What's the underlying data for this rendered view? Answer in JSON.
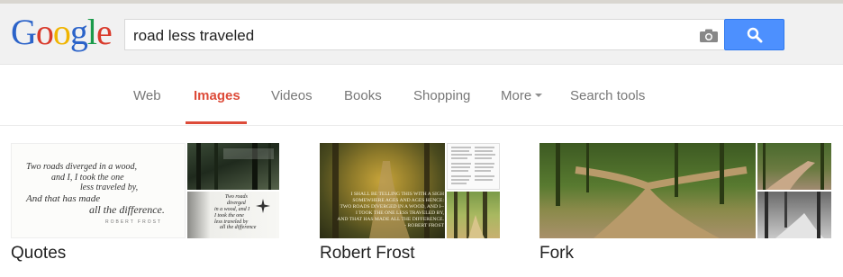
{
  "logo": {
    "letters": [
      "G",
      "o",
      "o",
      "g",
      "l",
      "e"
    ],
    "colors": [
      "#2b63c9",
      "#d93a2b",
      "#f0b400",
      "#2b63c9",
      "#1a9a4a",
      "#d93a2b"
    ]
  },
  "search": {
    "value": "road less traveled",
    "camera_icon": "camera-icon",
    "button_icon": "search-icon"
  },
  "nav": {
    "tabs": [
      {
        "label": "Web",
        "active": false
      },
      {
        "label": "Images",
        "active": true
      },
      {
        "label": "Videos",
        "active": false
      },
      {
        "label": "Books",
        "active": false
      },
      {
        "label": "Shopping",
        "active": false
      },
      {
        "label": "More",
        "active": false
      },
      {
        "label": "Search tools",
        "active": false
      }
    ],
    "active_color": "#dd4b39"
  },
  "cards": [
    {
      "label": "Quotes",
      "main_quote": [
        "Two roads diverged in a wood,",
        "and I, I took the one",
        "less traveled by,",
        "And that has made",
        "all the difference."
      ],
      "attribution": "ROBERT FROST",
      "side_bottom_quote": [
        "Two roads",
        "diverged",
        "in a wood, and I",
        "I took the one",
        "less traveled by",
        "all the difference"
      ]
    },
    {
      "label": "Robert Frost",
      "overlay_quote": [
        "I SHALL BE TELLING THIS WITH A SIGH",
        "SOMEWHERE AGES AND AGES HENCE:",
        "TWO ROADS DIVERGED IN A WOOD, AND I--",
        "I TOOK THE ONE LESS TRAVELED BY,",
        "AND THAT HAS MADE ALL THE DIFFERENCE.",
        "- ROBERT FROST"
      ]
    },
    {
      "label": "Fork"
    }
  ]
}
